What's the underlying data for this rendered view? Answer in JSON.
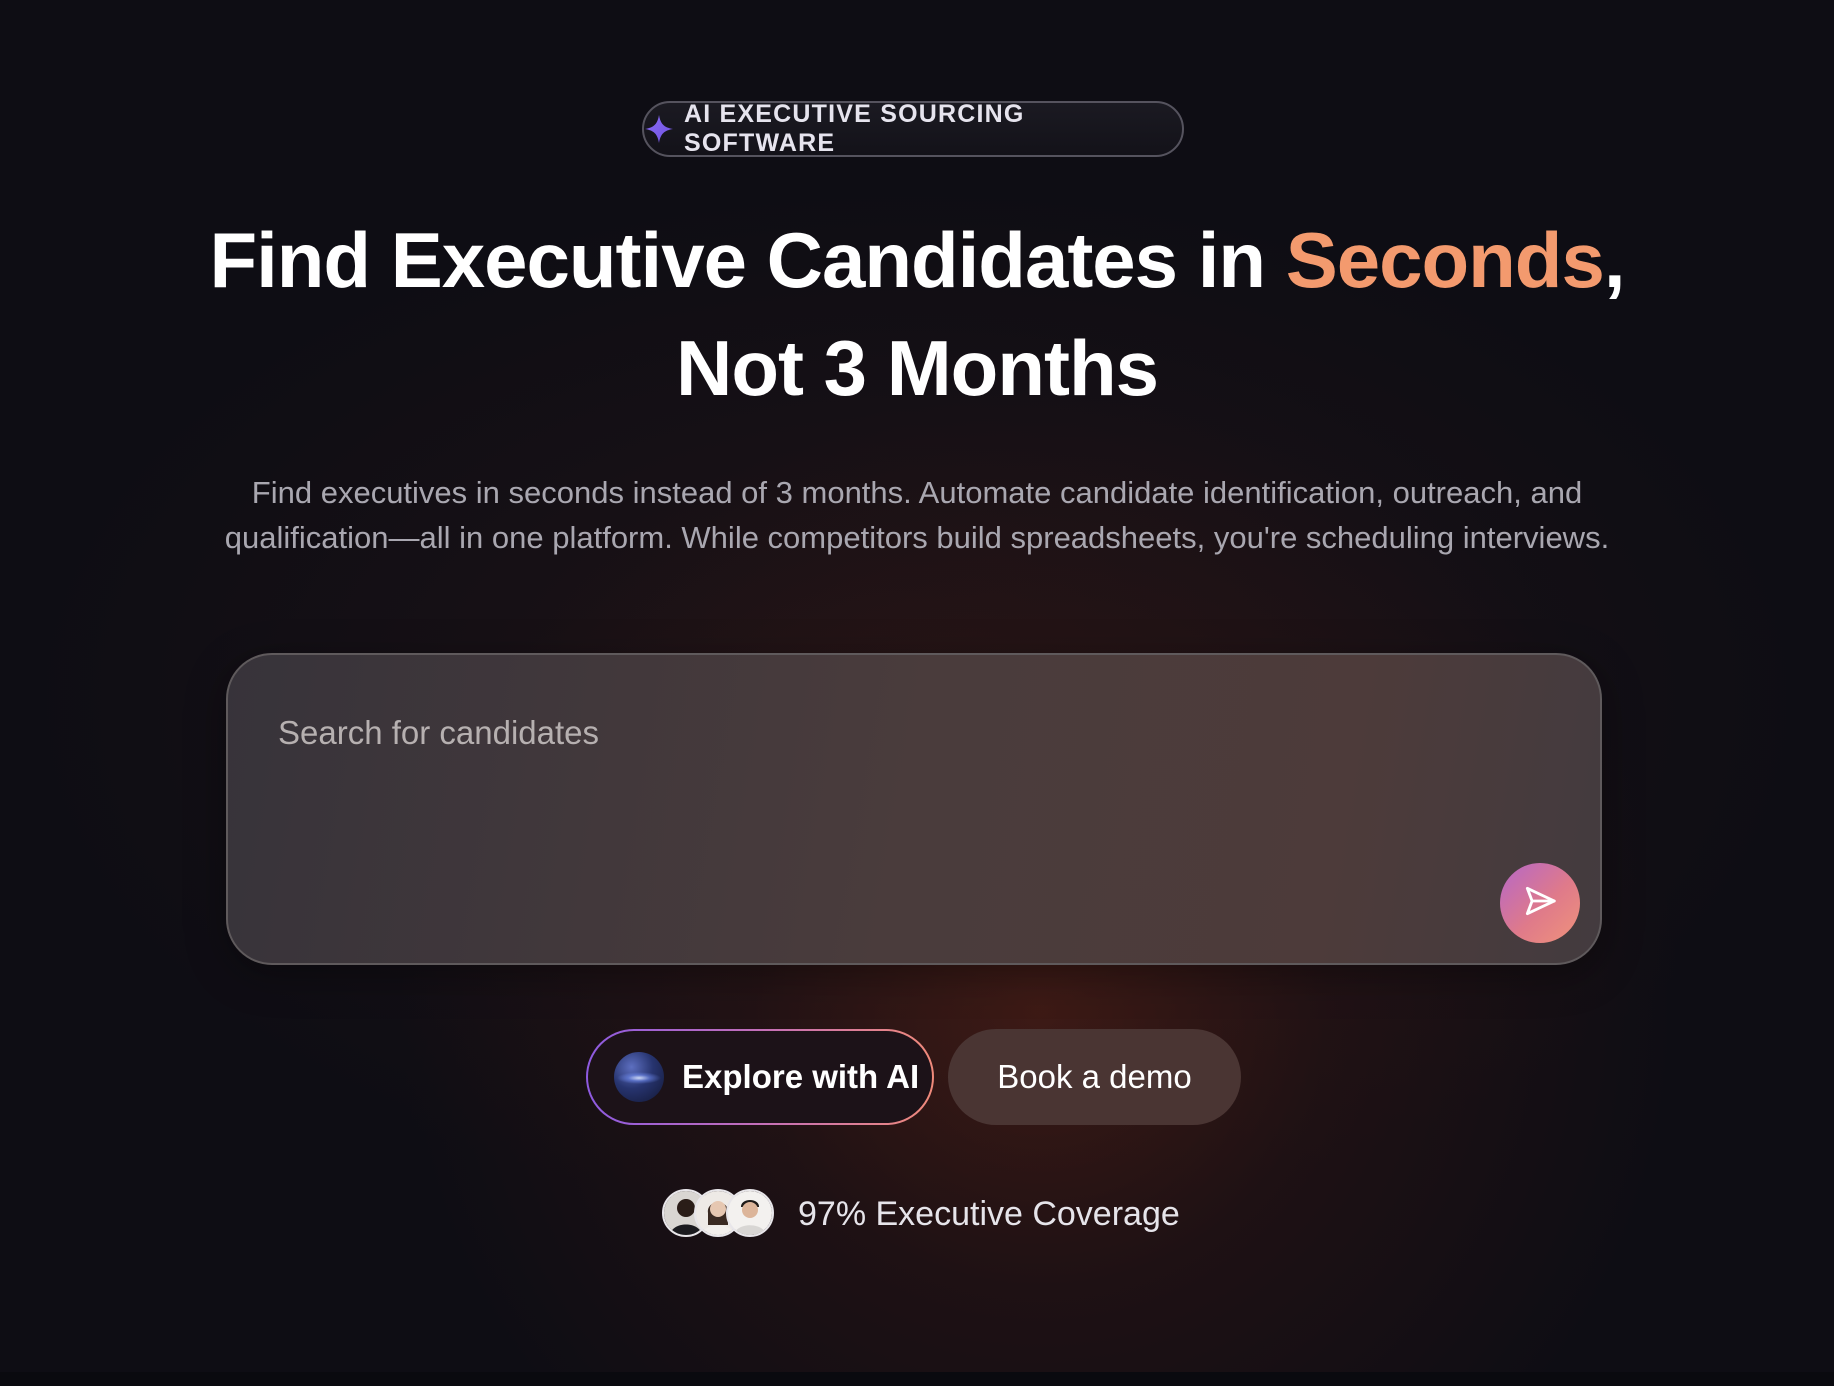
{
  "badge": {
    "icon": "sparkle-icon",
    "label": "AI EXECUTIVE SOURCING SOFTWARE"
  },
  "hero": {
    "title_part1": "Find Executive Candidates in ",
    "title_accent": "Seconds",
    "title_part2": ",",
    "title_line2": "Not 3 Months",
    "accent_color": "#f39a6e",
    "subtitle": "Find executives in seconds instead of 3 months. Automate candidate identification, outreach, and qualification—all in one platform. While competitors build spreadsheets, you're scheduling interviews."
  },
  "search": {
    "placeholder": "Search for candidates",
    "value": "",
    "submit_icon": "send-icon"
  },
  "actions": {
    "explore_label": "Explore with AI",
    "explore_icon": "ai-orb-icon",
    "demo_label": "Book a demo"
  },
  "coverage": {
    "label": "97% Executive Coverage",
    "avatars": [
      "avatar-1",
      "avatar-2",
      "avatar-3"
    ]
  }
}
